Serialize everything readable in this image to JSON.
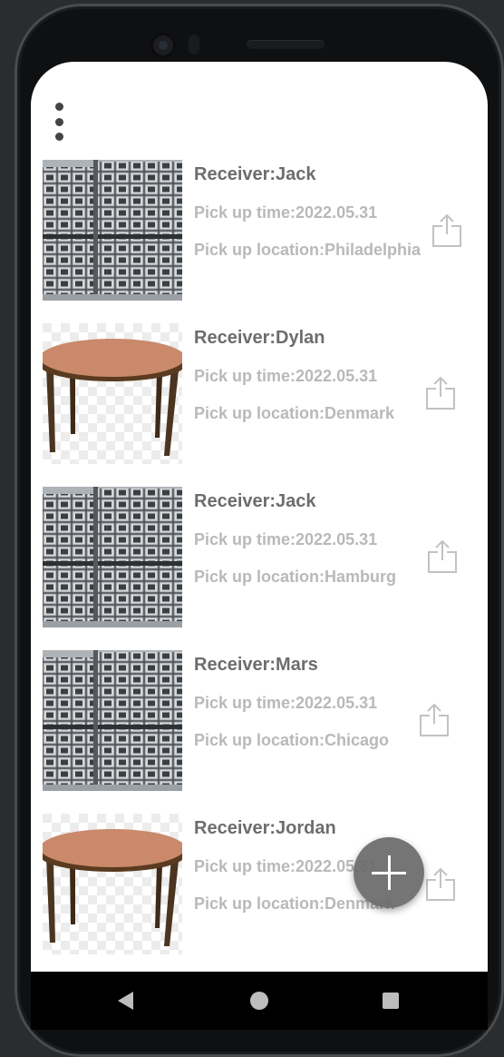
{
  "items": [
    {
      "receiver": "Receiver:Jack",
      "time": "Pick up time:2022.05.31",
      "location": "Pick up location:Philadelphia",
      "image": "steel-tubes"
    },
    {
      "receiver": "Receiver:Dylan",
      "time": "Pick up time:2022.05.31",
      "location": "Pick up location:Denmark",
      "image": "round-table"
    },
    {
      "receiver": "Receiver:Jack",
      "time": "Pick up time:2022.05.31",
      "location": "Pick up location:Hamburg",
      "image": "steel-tubes"
    },
    {
      "receiver": "Receiver:Mars",
      "time": "Pick up time:2022.05.31",
      "location": "Pick up location:Chicago",
      "image": "steel-tubes"
    },
    {
      "receiver": "Receiver:Jordan",
      "time": "Pick up time:2022.05.31",
      "location": "Pick up location:Denmark",
      "image": "round-table"
    }
  ],
  "icons": {
    "menu": "more-vert-icon",
    "share": "share-icon",
    "fab": "plus-icon",
    "nav": [
      "back-icon",
      "home-icon",
      "recents-icon"
    ]
  },
  "colors": {
    "receiver_text": "#6d6d6d",
    "detail_text": "#b9b9b9",
    "fab": "#696969",
    "table_top": "#c9896a",
    "table_legs": "#4b3520"
  }
}
